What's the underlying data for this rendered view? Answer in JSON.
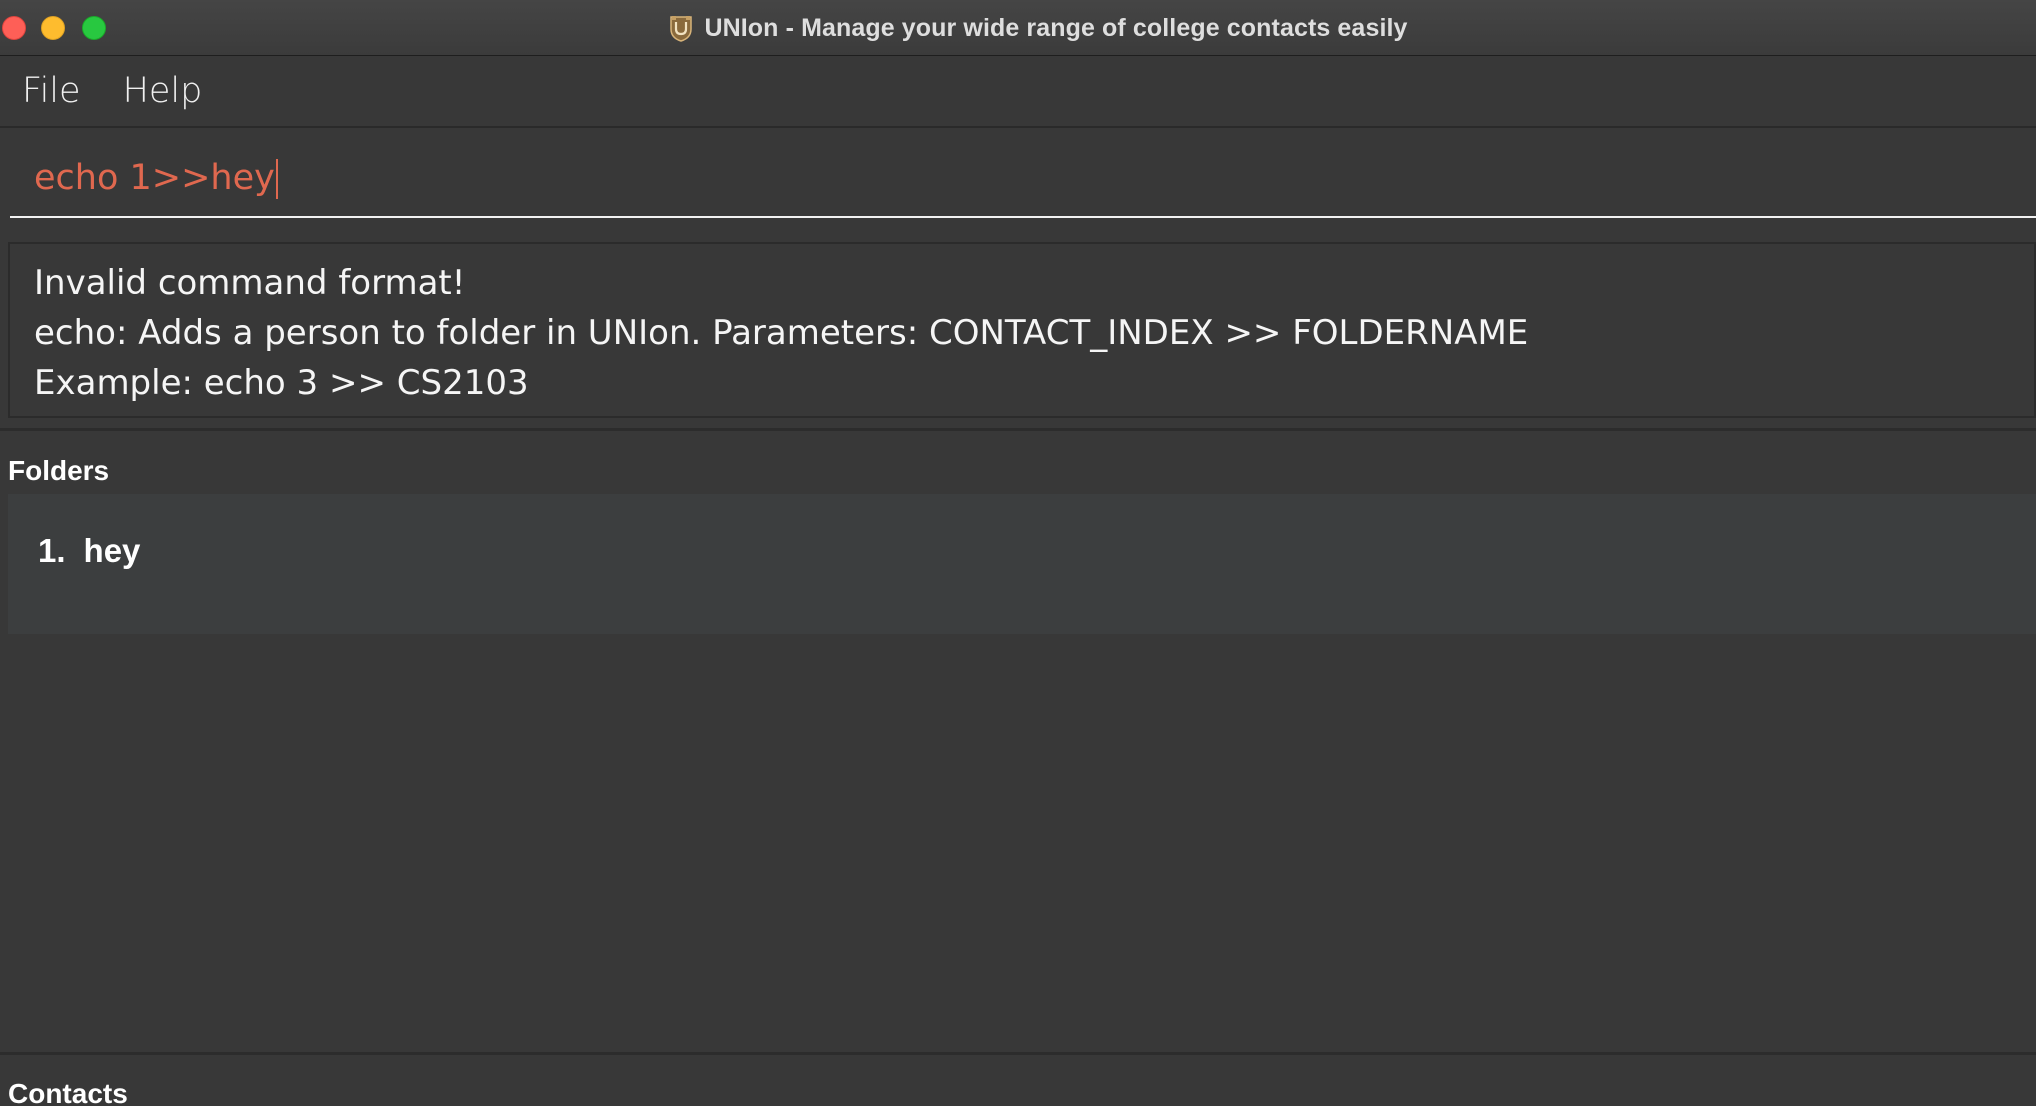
{
  "window": {
    "title": "UNIon - Manage your wide range of college contacts easily",
    "app_icon": "union-app-icon"
  },
  "menu": {
    "items": [
      {
        "label": "File"
      },
      {
        "label": "Help"
      }
    ]
  },
  "command": {
    "value": "echo 1>>hey",
    "text_color": "#e0684f"
  },
  "result": {
    "lines": [
      "Invalid command format!",
      "echo: Adds a person to folder in UNIon. Parameters: CONTACT_INDEX >> FOLDERNAME",
      "Example: echo 3 >> CS2103"
    ]
  },
  "folders": {
    "title": "Folders",
    "items": [
      {
        "index": "1.",
        "name": "hey"
      }
    ]
  },
  "contacts": {
    "title": "Contacts"
  },
  "colors": {
    "background": "#383838",
    "folder_list_bg": "#3c3e3f",
    "accent_error": "#e0684f"
  }
}
